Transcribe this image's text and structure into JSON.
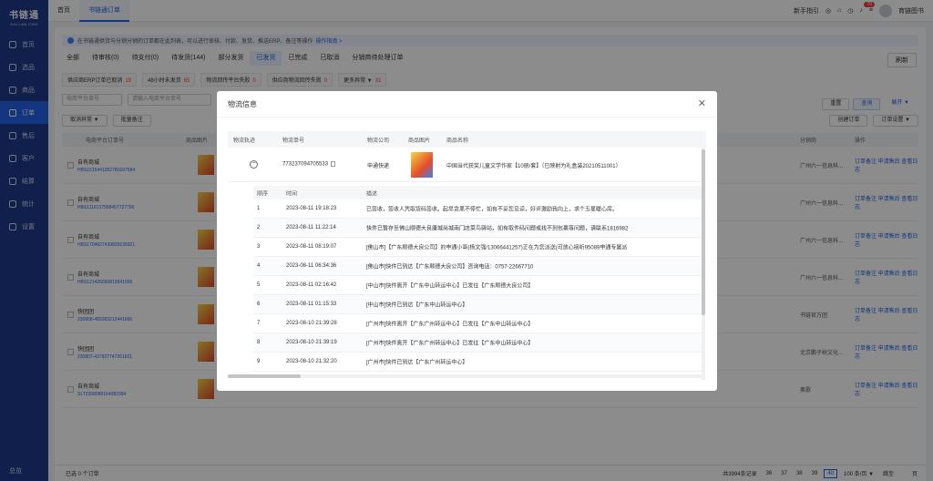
{
  "app": {
    "title": "书链通",
    "subtitle": "SHU LIAN TONG"
  },
  "sidebar": {
    "items": [
      {
        "label": "首页",
        "icon": "home-icon"
      },
      {
        "label": "选品",
        "icon": "select-icon"
      },
      {
        "label": "商品",
        "icon": "goods-icon"
      },
      {
        "label": "订单",
        "icon": "order-icon",
        "active": true
      },
      {
        "label": "售后",
        "icon": "aftersale-icon"
      },
      {
        "label": "客户",
        "icon": "customer-icon"
      },
      {
        "label": "结算",
        "icon": "settle-icon"
      },
      {
        "label": "统计",
        "icon": "stats-icon"
      },
      {
        "label": "设置",
        "icon": "settings-icon"
      }
    ],
    "bottom": "总览"
  },
  "topbar": {
    "tabs": [
      "首页",
      "书链通订单"
    ],
    "guide": "新手指引",
    "badge": "70",
    "user": "育链图书"
  },
  "notice": {
    "text": "在书链通供货与分销分销的订单都在此列表，可以进行审核、付款、发货、推送ERP、备注等操作",
    "link": "操作指南 >"
  },
  "order_tabs": [
    "全部",
    "待审核(0)",
    "待支付(0)",
    "待发货(144)",
    "部分发货",
    "已发货",
    "已完成",
    "已取消",
    "分销商待处理订单"
  ],
  "refresh": "刷新",
  "chips": [
    {
      "label": "供应商ERP订单已取消",
      "count": "19"
    },
    {
      "label": "48小时未发货",
      "count": "65"
    },
    {
      "label": "物流回传平台失败",
      "count": "0"
    },
    {
      "label": "供应商物流回传失败",
      "count": "0"
    },
    {
      "label": "更多异常 ▼",
      "count": "31"
    }
  ],
  "filter": {
    "select": "电商平台单号",
    "placeholder": "请输入电商平台单号",
    "reset": "重置",
    "query": "查询",
    "expand": "展开 ▼"
  },
  "actions": {
    "cancel": "取消异常 ▼",
    "batch_note": "批量备注",
    "create": "创建订单",
    "settings": "订单设置 ▼"
  },
  "table": {
    "headers": [
      "电商平台订单号",
      "商品图片",
      "分销商",
      "操作"
    ],
    "rows": [
      {
        "shop": "自有商城",
        "no": "HBS1515441052781697584",
        "dist": "广州六一信息科...",
        "op": "订单备注 申请售后 查看日志"
      },
      {
        "shop": "自有商城",
        "no": "HBS1116157998457727796",
        "dist": "广州六一信息科...",
        "op": "订单备注 申请售后 查看日志"
      },
      {
        "shop": "自有商城",
        "no": "HBS1704927439826635921",
        "dist": "广州六一信息科...",
        "op": "订单备注 申请售后 查看日志"
      },
      {
        "shop": "自有商城",
        "no": "HBS121426660819941656",
        "dist": "广州六一信息科...",
        "op": "订单备注 申请售后 查看日志"
      },
      {
        "shop": "快团团",
        "no": "230808-480383212441666",
        "dist": "书链官方团",
        "op": "订单备注 申请售后 查看日志"
      },
      {
        "shop": "快团团",
        "no": "230807-437827747261621",
        "dist": "北京鹏子树文化...",
        "op": "订单备注 申请售后 查看日志"
      },
      {
        "shop": "自有商城",
        "no": "SLT2308080164082994",
        "dist": "奥歌",
        "op": "订单备注 申请售后 查看日志"
      }
    ]
  },
  "footer": {
    "selected": "已选 0 个订单",
    "total": "共3994条记录",
    "pages": [
      "36",
      "37",
      "38",
      "39",
      "40"
    ],
    "current": "40",
    "per": "100 条/页 ▼",
    "goto": "跳至",
    "page_unit": "页"
  },
  "modal": {
    "title": "物流信息",
    "headers": [
      "物流轨迹",
      "物流单号",
      "物流公司",
      "商品图片",
      "商品名称"
    ],
    "tracking_no": "773237094705533",
    "company": "申通快递",
    "product": "中国当代获奖儿童文学作家【10册/套】（已映射为礼盒装20210511001）",
    "track_headers": [
      "顺序",
      "时间",
      "描述"
    ],
    "tracks": [
      {
        "seq": "1",
        "time": "2023-08-11 19:18:23",
        "desc": "已签收，签收人凭取货码签收。起早贪黑不停忙，如有不妥您见谅，好评激励我向上，求个五星暖心房。"
      },
      {
        "seq": "2",
        "time": "2023-08-11 11:22:14",
        "desc": "快件已暂存至佛山顺德大良康城尚城南门店菜鸟驿站，如有取件码问题或找不到包裹等问题，请联系1816982"
      },
      {
        "seq": "3",
        "time": "2023-08-11 08:19:07",
        "desc": "[佛山市]【广东顺德大良公司】的申通小哥(杨文强/13066441257)正在为您派送(可放心接听95089申通专属派"
      },
      {
        "seq": "4",
        "time": "2023-08-11 06:34:36",
        "desc": "[佛山市]快件已到达【广东顺德大良公司】咨询电话：0757-22667710"
      },
      {
        "seq": "5",
        "time": "2023-08-11 02:16:42",
        "desc": "[中山市]快件离开【广东中山转运中心】已发往【广东顺德大良公司】"
      },
      {
        "seq": "6",
        "time": "2023-08-11 01:15:33",
        "desc": "[中山市]快件已到达【广东中山转运中心】"
      },
      {
        "seq": "7",
        "time": "2023-08-10 21:39:28",
        "desc": "[广州市]快件离开【广东广州转运中心】已发往【广东中山转运中心】"
      },
      {
        "seq": "8",
        "time": "2023-08-10 21:39:19",
        "desc": "[广州市]快件离开【广东广州转运中心】已发往【广东中山转运中心】"
      },
      {
        "seq": "9",
        "time": "2023-08-10 21:32:20",
        "desc": "[广州市]快件已到达【广东广州转运中心】"
      }
    ]
  }
}
